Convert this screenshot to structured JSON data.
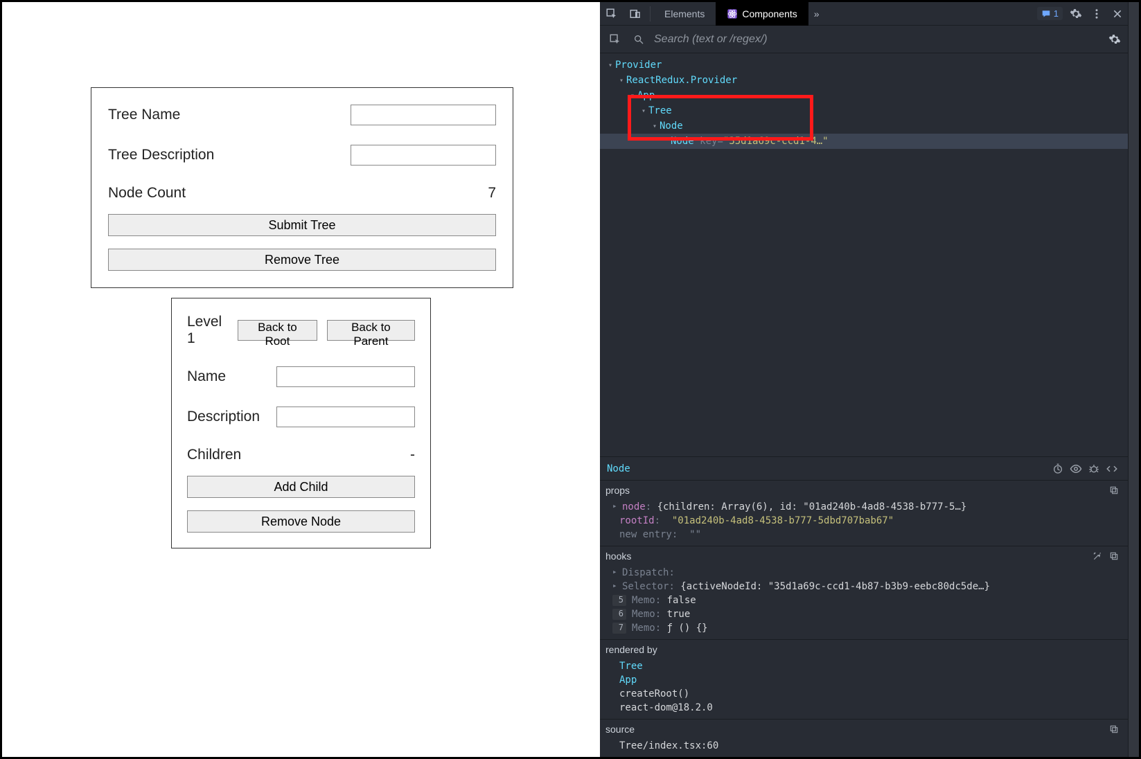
{
  "devtools": {
    "tabs": {
      "elements": "Elements",
      "components": "Components"
    },
    "messages_count": "1",
    "search": {
      "placeholder": "Search (text or /regex/)"
    },
    "tree": {
      "provider": "Provider",
      "reactredux": "ReactRedux.Provider",
      "app": "App",
      "tree_comp": "Tree",
      "node1": "Node",
      "node2": "Node",
      "node2_key_label": "key",
      "node2_key_value": "\"35d1a69c-ccd1-4…\""
    },
    "selected": {
      "name": "Node"
    },
    "props": {
      "header": "props",
      "node_key": "node",
      "node_val": "{children: Array(6), id: \"01ad240b-4ad8-4538-b777-5…}",
      "rootId_key": "rootId",
      "rootId_val": "\"01ad240b-4ad8-4538-b777-5dbd707bab67\"",
      "newentry_key": "new entry",
      "newentry_val": "\"\""
    },
    "hooks": {
      "header": "hooks",
      "dispatch": "Dispatch",
      "selector_key": "Selector",
      "selector_val": "{activeNodeId: \"35d1a69c-ccd1-4b87-b3b9-eebc80dc5de…}",
      "memo5_n": "5",
      "memo5_k": "Memo",
      "memo5_v": "false",
      "memo6_n": "6",
      "memo6_k": "Memo",
      "memo6_v": "true",
      "memo7_n": "7",
      "memo7_k": "Memo",
      "memo7_v": "ƒ () {}"
    },
    "rendered": {
      "header": "rendered by",
      "tree": "Tree",
      "app": "App",
      "create": "createRoot()",
      "reactdom": "react-dom@18.2.0"
    },
    "source": {
      "header": "source",
      "path": "Tree/index.tsx:60"
    }
  },
  "app": {
    "tree_panel": {
      "tree_name_label": "Tree Name",
      "tree_desc_label": "Tree Description",
      "node_count_label": "Node Count",
      "node_count_value": "7",
      "submit_btn": "Submit Tree",
      "remove_btn": "Remove Tree"
    },
    "node_panel": {
      "level_label": "Level 1",
      "back_root": "Back to Root",
      "back_parent": "Back to Parent",
      "name_label": "Name",
      "desc_label": "Description",
      "children_label": "Children",
      "children_value": "-",
      "add_child": "Add Child",
      "remove_node": "Remove Node"
    }
  }
}
